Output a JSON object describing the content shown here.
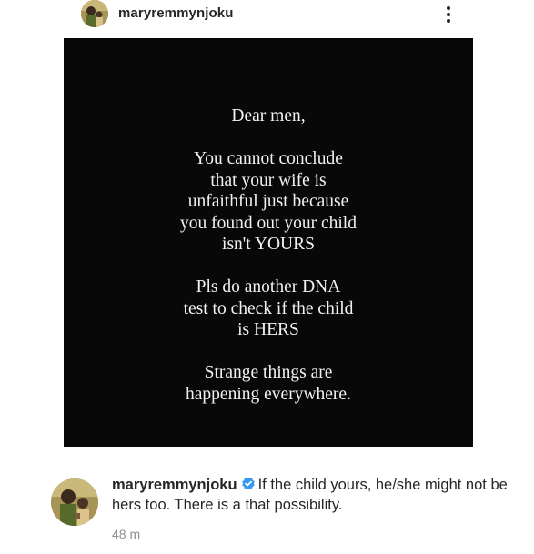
{
  "post": {
    "username": "maryremmynjoku",
    "more_icon": "more-vertical-icon",
    "image_text": [
      "Dear men,",
      "You cannot conclude\nthat your wife is\nunfaithful just because\nyou found out your child\nisn't YOURS",
      "Pls do another DNA\ntest to check if the child\nis HERS",
      "Strange things are\nhappening everywhere."
    ]
  },
  "comment": {
    "username": "maryremmynjoku",
    "verified_icon": "verified-badge-icon",
    "text": "If the child yours, he/she might not be hers too. There is a that possibility.",
    "time": "48 m"
  },
  "colors": {
    "image_background": "#080808",
    "image_text": "#f2f2f2",
    "verified_blue": "#3897f0",
    "timestamp_gray": "#8e8e8e"
  }
}
